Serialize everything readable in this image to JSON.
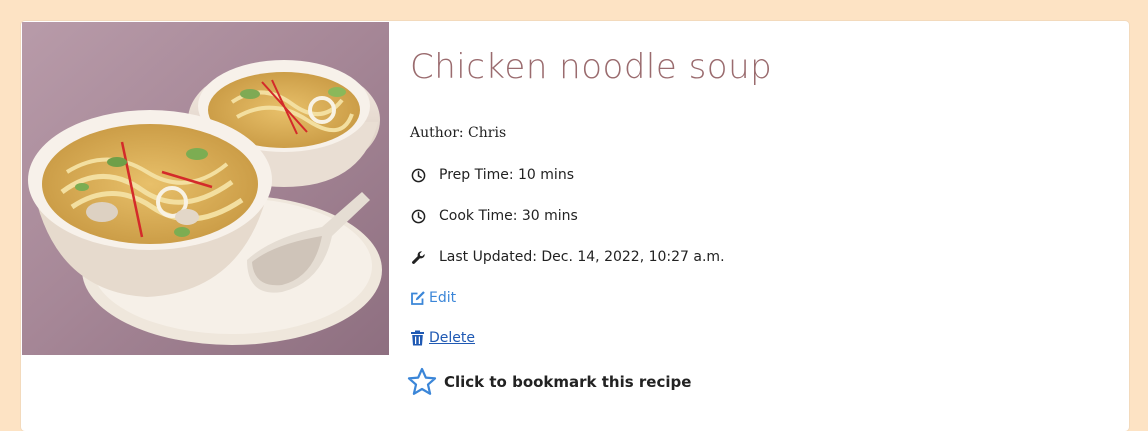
{
  "recipe": {
    "title": "Chicken noodle soup",
    "author": "Author: Chris",
    "prep_time": "Prep Time: 10 mins",
    "cook_time": "Cook Time: 30 mins",
    "last_updated": "Last Updated: Dec. 14, 2022, 10:27 a.m."
  },
  "actions": {
    "edit_label": "Edit",
    "delete_label": "Delete",
    "bookmark_label": "Click to bookmark this recipe"
  },
  "icons": {
    "prep": "clock-icon",
    "cook": "clock-icon",
    "updated": "wrench-icon",
    "edit": "edit-icon",
    "delete": "trash-icon",
    "bookmark": "star-outline-icon"
  },
  "colors": {
    "page_background": "#fde3c4",
    "title": "#9a6b6e",
    "link": "#3b86d8",
    "delete_link": "#1f59b3",
    "star": "#3b86d8"
  }
}
